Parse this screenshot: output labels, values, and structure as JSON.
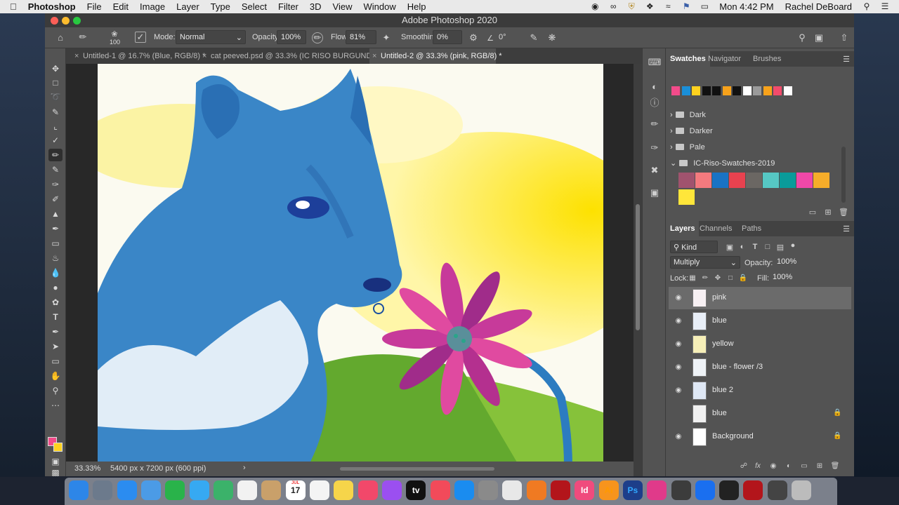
{
  "menubar": {
    "app_name": "Photoshop",
    "menus": [
      "File",
      "Edit",
      "Image",
      "Layer",
      "Type",
      "Select",
      "Filter",
      "3D",
      "View",
      "Window",
      "Help"
    ],
    "clock": "Mon 4:42 PM",
    "user": "Rachel DeBoard"
  },
  "window": {
    "title": "Adobe Photoshop 2020"
  },
  "options": {
    "brush_size": "100",
    "mode_label": "Mode:",
    "mode_value": "Normal",
    "opacity_label": "Opacity:",
    "opacity_value": "100%",
    "flow_label": "Flow:",
    "flow_value": "81%",
    "smoothing_label": "Smoothing:",
    "smoothing_value": "0%",
    "angle_value": "0°"
  },
  "tabs": [
    {
      "label": "Untitled-1 @ 16.7% (Blue, RGB/8) *"
    },
    {
      "label": "cat peeved.psd @ 33.3% (IC RISO BURGUNDY/8)"
    },
    {
      "label": "Untitled-2 @ 33.3% (pink, RGB/8) *"
    }
  ],
  "status": {
    "zoom": "33.33%",
    "doc_info": "5400 px x 7200 px (600 ppi)"
  },
  "swatches_panel": {
    "tabs": [
      "Swatches",
      "Navigator",
      "Brushes"
    ],
    "recent_colors": [
      "#f24b8a",
      "#1a8fd8",
      "#ffd21f",
      "#111111",
      "#111111",
      "#f7a21b",
      "#111111",
      "#ffffff",
      "#9a9a9a",
      "#f7a21b",
      "#f24b6b",
      "#ffffff"
    ],
    "groups": [
      {
        "name": "Dark"
      },
      {
        "name": "Darker"
      },
      {
        "name": "Pale"
      },
      {
        "name": "IC-Riso-Swatches-2019"
      }
    ],
    "riso_colors": [
      "#a0536e",
      "#f47a7e",
      "#1a73c4",
      "#e8424f",
      "#6b6763",
      "#56c8c4",
      "#0a9b9a",
      "#f048a8",
      "#f6ad2a",
      "#ffe63a"
    ]
  },
  "layers_panel": {
    "tabs": [
      "Layers",
      "Channels",
      "Paths"
    ],
    "filter_label": "Kind",
    "blend_mode": "Multiply",
    "opacity_label": "Opacity:",
    "opacity_value": "100%",
    "lock_label": "Lock:",
    "fill_label": "Fill:",
    "fill_value": "100%",
    "layers": [
      {
        "name": "pink",
        "locked": false,
        "visible": true,
        "selected": true
      },
      {
        "name": "blue",
        "locked": false,
        "visible": true,
        "selected": false
      },
      {
        "name": "yellow",
        "locked": false,
        "visible": true,
        "selected": false
      },
      {
        "name": "blue - flower /3",
        "locked": false,
        "visible": true,
        "selected": false
      },
      {
        "name": "blue 2",
        "locked": false,
        "visible": true,
        "selected": false
      },
      {
        "name": "blue",
        "locked": true,
        "visible": false,
        "selected": false
      },
      {
        "name": "Background",
        "locked": true,
        "visible": true,
        "selected": false
      }
    ]
  },
  "dock": {
    "apps": [
      "Finder",
      "Launchpad",
      "Safari",
      "Preview",
      "FaceTime",
      "Messages",
      "Maps",
      "Photos",
      "Contacts",
      "Calendar",
      "Notes",
      "Stickies",
      "Music",
      "Podcasts",
      "TV",
      "News",
      "App Store",
      "System Preferences",
      "Chrome",
      "Firefox",
      "Acrobat",
      "InDesign",
      "Illustrator",
      "Photoshop",
      "Creative Cloud",
      "QuickTime",
      "Dropbox",
      "Screenshot",
      "PDF",
      "Archive",
      "Trash"
    ],
    "calendar_month": "JUL",
    "calendar_day": "17",
    "appletv_label": "tv",
    "id_label": "Id",
    "ai_label": "Ai",
    "ps_label": "Ps"
  },
  "colors": {
    "foreground": "#f24b8a",
    "background": "#ffd21f"
  }
}
